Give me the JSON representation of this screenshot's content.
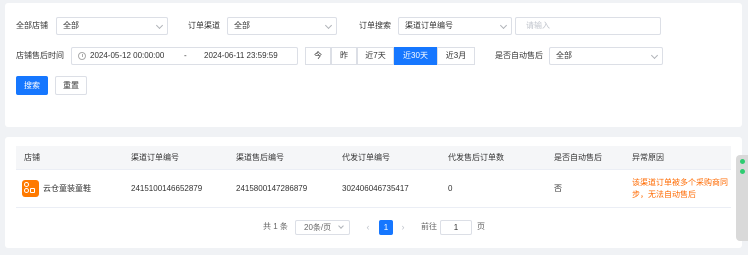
{
  "filters": {
    "store_label": "全部店铺",
    "store_value": "全部",
    "channel_label": "订单渠道",
    "channel_value": "全部",
    "search_label": "订单搜索",
    "search_type_value": "渠道订单编号",
    "search_placeholder": "请输入",
    "time_label": "店铺售后时间",
    "date_start": "2024-05-12 00:00:00",
    "date_sep": "-",
    "date_end": "2024-06-11 23:59:59",
    "quick_ranges": [
      "今",
      "昨",
      "近7天",
      "近30天",
      "近3月"
    ],
    "quick_range_active": "近30天",
    "auto_after_sale_label": "是否自动售后",
    "auto_after_sale_value": "全部",
    "search_button": "搜索",
    "reset_button": "重置"
  },
  "table": {
    "columns": [
      "店铺",
      "渠道订单编号",
      "渠道售后编号",
      "代发订单编号",
      "代发售后订单数",
      "是否自动售后",
      "异常原因"
    ],
    "rows": [
      {
        "store": "云仓童装童鞋",
        "channel_order_no": "2415100146652879",
        "channel_after_sale_no": "2415800147286879",
        "dropship_order_no": "302406046735417",
        "dropship_after_sale_count": "0",
        "auto_after_sale": "否",
        "error_reason": "该渠道订单被多个采购商同步，无法自动售后"
      }
    ]
  },
  "pagination": {
    "total_text": "共 1 条",
    "page_size": "20条/页",
    "prev": "‹",
    "current_page": "1",
    "next": "›",
    "goto_label": "前往",
    "goto_value": "1",
    "page_unit": "页"
  },
  "colors": {
    "primary": "#1677ff",
    "error_text": "#ff6a00",
    "store_logo": "#ff7a00"
  }
}
